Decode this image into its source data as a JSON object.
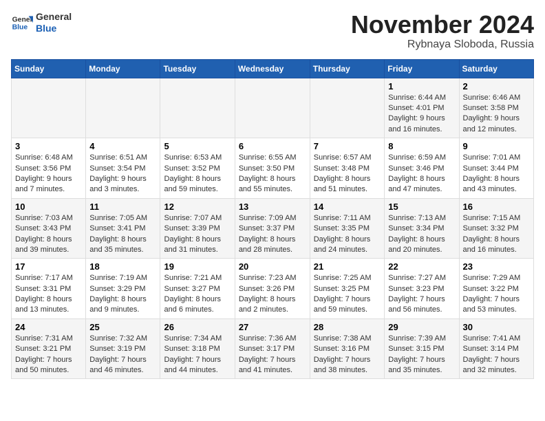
{
  "logo": {
    "line1": "General",
    "line2": "Blue"
  },
  "title": "November 2024",
  "location": "Rybnaya Sloboda, Russia",
  "headers": [
    "Sunday",
    "Monday",
    "Tuesday",
    "Wednesday",
    "Thursday",
    "Friday",
    "Saturday"
  ],
  "weeks": [
    [
      {
        "day": "",
        "info": ""
      },
      {
        "day": "",
        "info": ""
      },
      {
        "day": "",
        "info": ""
      },
      {
        "day": "",
        "info": ""
      },
      {
        "day": "",
        "info": ""
      },
      {
        "day": "1",
        "info": "Sunrise: 6:44 AM\nSunset: 4:01 PM\nDaylight: 9 hours and 16 minutes."
      },
      {
        "day": "2",
        "info": "Sunrise: 6:46 AM\nSunset: 3:58 PM\nDaylight: 9 hours and 12 minutes."
      }
    ],
    [
      {
        "day": "3",
        "info": "Sunrise: 6:48 AM\nSunset: 3:56 PM\nDaylight: 9 hours and 7 minutes."
      },
      {
        "day": "4",
        "info": "Sunrise: 6:51 AM\nSunset: 3:54 PM\nDaylight: 9 hours and 3 minutes."
      },
      {
        "day": "5",
        "info": "Sunrise: 6:53 AM\nSunset: 3:52 PM\nDaylight: 8 hours and 59 minutes."
      },
      {
        "day": "6",
        "info": "Sunrise: 6:55 AM\nSunset: 3:50 PM\nDaylight: 8 hours and 55 minutes."
      },
      {
        "day": "7",
        "info": "Sunrise: 6:57 AM\nSunset: 3:48 PM\nDaylight: 8 hours and 51 minutes."
      },
      {
        "day": "8",
        "info": "Sunrise: 6:59 AM\nSunset: 3:46 PM\nDaylight: 8 hours and 47 minutes."
      },
      {
        "day": "9",
        "info": "Sunrise: 7:01 AM\nSunset: 3:44 PM\nDaylight: 8 hours and 43 minutes."
      }
    ],
    [
      {
        "day": "10",
        "info": "Sunrise: 7:03 AM\nSunset: 3:43 PM\nDaylight: 8 hours and 39 minutes."
      },
      {
        "day": "11",
        "info": "Sunrise: 7:05 AM\nSunset: 3:41 PM\nDaylight: 8 hours and 35 minutes."
      },
      {
        "day": "12",
        "info": "Sunrise: 7:07 AM\nSunset: 3:39 PM\nDaylight: 8 hours and 31 minutes."
      },
      {
        "day": "13",
        "info": "Sunrise: 7:09 AM\nSunset: 3:37 PM\nDaylight: 8 hours and 28 minutes."
      },
      {
        "day": "14",
        "info": "Sunrise: 7:11 AM\nSunset: 3:35 PM\nDaylight: 8 hours and 24 minutes."
      },
      {
        "day": "15",
        "info": "Sunrise: 7:13 AM\nSunset: 3:34 PM\nDaylight: 8 hours and 20 minutes."
      },
      {
        "day": "16",
        "info": "Sunrise: 7:15 AM\nSunset: 3:32 PM\nDaylight: 8 hours and 16 minutes."
      }
    ],
    [
      {
        "day": "17",
        "info": "Sunrise: 7:17 AM\nSunset: 3:31 PM\nDaylight: 8 hours and 13 minutes."
      },
      {
        "day": "18",
        "info": "Sunrise: 7:19 AM\nSunset: 3:29 PM\nDaylight: 8 hours and 9 minutes."
      },
      {
        "day": "19",
        "info": "Sunrise: 7:21 AM\nSunset: 3:27 PM\nDaylight: 8 hours and 6 minutes."
      },
      {
        "day": "20",
        "info": "Sunrise: 7:23 AM\nSunset: 3:26 PM\nDaylight: 8 hours and 2 minutes."
      },
      {
        "day": "21",
        "info": "Sunrise: 7:25 AM\nSunset: 3:25 PM\nDaylight: 7 hours and 59 minutes."
      },
      {
        "day": "22",
        "info": "Sunrise: 7:27 AM\nSunset: 3:23 PM\nDaylight: 7 hours and 56 minutes."
      },
      {
        "day": "23",
        "info": "Sunrise: 7:29 AM\nSunset: 3:22 PM\nDaylight: 7 hours and 53 minutes."
      }
    ],
    [
      {
        "day": "24",
        "info": "Sunrise: 7:31 AM\nSunset: 3:21 PM\nDaylight: 7 hours and 50 minutes."
      },
      {
        "day": "25",
        "info": "Sunrise: 7:32 AM\nSunset: 3:19 PM\nDaylight: 7 hours and 46 minutes."
      },
      {
        "day": "26",
        "info": "Sunrise: 7:34 AM\nSunset: 3:18 PM\nDaylight: 7 hours and 44 minutes."
      },
      {
        "day": "27",
        "info": "Sunrise: 7:36 AM\nSunset: 3:17 PM\nDaylight: 7 hours and 41 minutes."
      },
      {
        "day": "28",
        "info": "Sunrise: 7:38 AM\nSunset: 3:16 PM\nDaylight: 7 hours and 38 minutes."
      },
      {
        "day": "29",
        "info": "Sunrise: 7:39 AM\nSunset: 3:15 PM\nDaylight: 7 hours and 35 minutes."
      },
      {
        "day": "30",
        "info": "Sunrise: 7:41 AM\nSunset: 3:14 PM\nDaylight: 7 hours and 32 minutes."
      }
    ]
  ]
}
